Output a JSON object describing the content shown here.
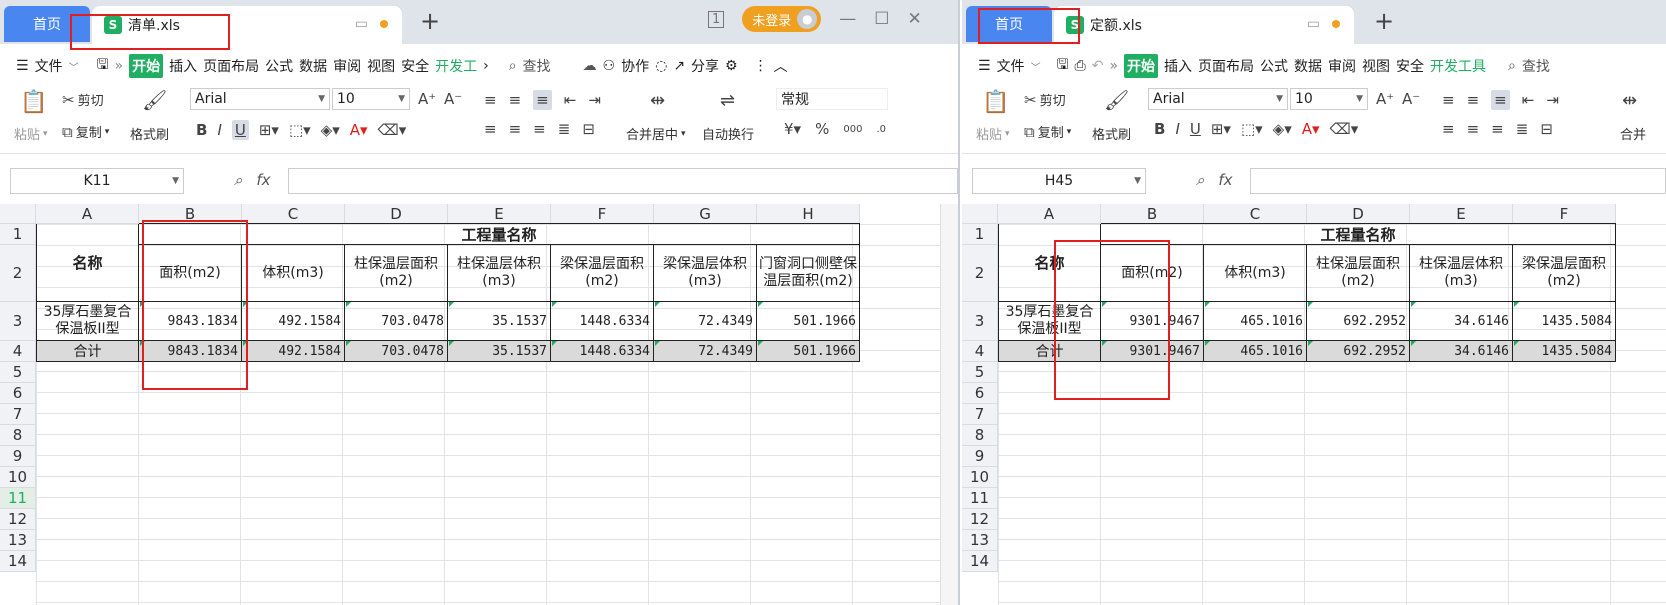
{
  "left": {
    "tab_home": "首页",
    "tab_doc": "清单.xls",
    "sheet_badge": "1",
    "login": "未登录",
    "menu": [
      "文件",
      "开始",
      "插入",
      "页面布局",
      "公式",
      "数据",
      "审阅",
      "视图",
      "安全",
      "开发工"
    ],
    "search": "查找",
    "collab": "协作",
    "share": "分享",
    "font": "Arial",
    "size": "10",
    "numfmt": "常规",
    "name_box": "K11",
    "cols": [
      "A",
      "B",
      "C",
      "D",
      "E",
      "F",
      "G",
      "H"
    ],
    "rows": [
      "1",
      "2",
      "3",
      "4",
      "5",
      "6",
      "7",
      "8",
      "9",
      "10",
      "11",
      "12",
      "13",
      "14"
    ],
    "selected_row": "11",
    "header_name": "名称",
    "header_group": "工程量名称",
    "subheaders": [
      "面积(m2)",
      "体积(m3)",
      "柱保温层面积(m2)",
      "柱保温层体积(m3)",
      "梁保温层面积(m2)",
      "梁保温层体积(m3)",
      "门窗洞口侧壁保温层面积(m2)"
    ],
    "row3_name": "35厚石墨复合保温板II型",
    "row3_values": [
      "9843.1834",
      "492.1584",
      "703.0478",
      "35.1537",
      "1448.6334",
      "72.4349",
      "501.1966"
    ],
    "total_label": "合计",
    "total_values": [
      "9843.1834",
      "492.1584",
      "703.0478",
      "35.1537",
      "1448.6334",
      "72.4349",
      "501.1966"
    ]
  },
  "right": {
    "tab_home": "首页",
    "tab_doc": "定额.xls",
    "menu": [
      "文件",
      "开始",
      "插入",
      "页面布局",
      "公式",
      "数据",
      "审阅",
      "视图",
      "安全",
      "开发工具"
    ],
    "search": "查找",
    "font": "Arial",
    "size": "10",
    "name_box": "H45",
    "cols": [
      "A",
      "B",
      "C",
      "D",
      "E",
      "F"
    ],
    "rows": [
      "1",
      "2",
      "3",
      "4",
      "5",
      "6",
      "7",
      "8",
      "9",
      "10",
      "11",
      "12",
      "13",
      "14"
    ],
    "header_name": "名称",
    "header_group": "工程量名称",
    "subheaders": [
      "面积(m2)",
      "体积(m3)",
      "柱保温层面积(m2)",
      "柱保温层体积(m3)",
      "梁保温层面积(m2)"
    ],
    "row3_name": "35厚石墨复合保温板II型",
    "row3_values": [
      "9301.9467",
      "465.1016",
      "692.2952",
      "34.6146",
      "1435.5084"
    ],
    "total_label": "合计",
    "total_values": [
      "9301.9467",
      "465.1016",
      "692.2952",
      "34.6146",
      "1435.5084"
    ]
  },
  "toolbar": {
    "paste": "粘贴",
    "cut": "剪切",
    "copy": "复制",
    "format_painter": "格式刷",
    "merge_center": "合并居中",
    "merge_short": "合并",
    "wrap": "自动换行"
  },
  "colors": {
    "accent": "#1fae62",
    "home_tab": "#4a86f0",
    "highlight": "#e02020",
    "login": "#f0a020"
  }
}
